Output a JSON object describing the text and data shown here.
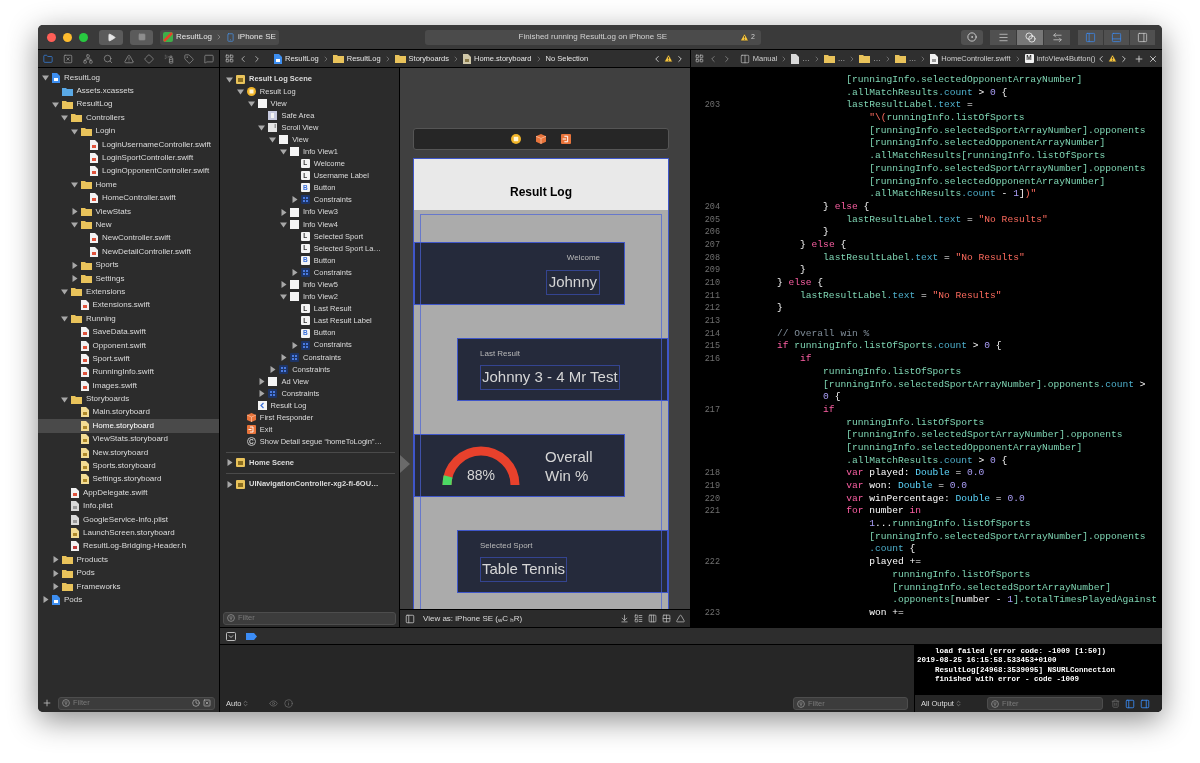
{
  "toolbar": {
    "scheme": "ResultLog",
    "device": "iPhone SE",
    "status": "Finished running ResultLog on iPhone SE",
    "warning_count": "2",
    "editor_modes": [
      {
        "kind": "standard",
        "selected": false
      },
      {
        "kind": "assistant",
        "selected": true
      },
      {
        "kind": "version",
        "selected": false
      }
    ],
    "panels": [
      {
        "kind": "navigator",
        "on": true
      },
      {
        "kind": "debug",
        "on": true
      },
      {
        "kind": "inspector",
        "on": false
      }
    ]
  },
  "navigator": {
    "tabs": [
      {
        "kind": "project",
        "selected": true
      },
      {
        "kind": "source-control",
        "selected": false
      },
      {
        "kind": "symbol",
        "selected": false
      },
      {
        "kind": "find",
        "selected": false
      },
      {
        "kind": "issue",
        "selected": false
      },
      {
        "kind": "test",
        "selected": false
      },
      {
        "kind": "debug",
        "selected": false
      },
      {
        "kind": "breakpoint",
        "selected": false
      },
      {
        "kind": "report",
        "selected": false
      }
    ],
    "tree": [
      {
        "label": "ResultLog",
        "kind": "project",
        "expanded": true,
        "selected": false,
        "children": [
          {
            "label": "Assets.xcassets",
            "kind": "assets",
            "selected": false
          },
          {
            "label": "ResultLog",
            "kind": "folder",
            "expanded": true,
            "selected": false,
            "children": [
              {
                "label": "Controllers",
                "kind": "folder",
                "expanded": true,
                "selected": false,
                "children": [
                  {
                    "label": "Login",
                    "kind": "folder",
                    "expanded": true,
                    "selected": false,
                    "children": [
                      {
                        "label": "LoginUsernameController.swift",
                        "kind": "swift",
                        "selected": false
                      },
                      {
                        "label": "LoginSportController.swift",
                        "kind": "swift",
                        "selected": false
                      },
                      {
                        "label": "LoginOpponentController.swift",
                        "kind": "swift",
                        "selected": false
                      }
                    ]
                  },
                  {
                    "label": "Home",
                    "kind": "folder",
                    "expanded": true,
                    "selected": false,
                    "children": [
                      {
                        "label": "HomeController.swift",
                        "kind": "swift",
                        "selected": false
                      }
                    ]
                  },
                  {
                    "label": "ViewStats",
                    "kind": "folder",
                    "expanded": false,
                    "selected": false
                  },
                  {
                    "label": "New",
                    "kind": "folder",
                    "expanded": true,
                    "selected": false,
                    "children": [
                      {
                        "label": "NewController.swift",
                        "kind": "swift",
                        "selected": false
                      },
                      {
                        "label": "NewDetailController.swift",
                        "kind": "swift",
                        "selected": false
                      }
                    ]
                  },
                  {
                    "label": "Sports",
                    "kind": "folder",
                    "expanded": false,
                    "selected": false
                  },
                  {
                    "label": "Settings",
                    "kind": "folder",
                    "expanded": false,
                    "selected": false
                  }
                ]
              },
              {
                "label": "Extensions",
                "kind": "folder",
                "expanded": true,
                "selected": false,
                "children": [
                  {
                    "label": "Extensions.swift",
                    "kind": "swift",
                    "selected": false
                  }
                ]
              },
              {
                "label": "Running",
                "kind": "folder",
                "expanded": true,
                "selected": false,
                "children": [
                  {
                    "label": "SaveData.swift",
                    "kind": "swift",
                    "selected": false
                  },
                  {
                    "label": "Opponent.swift",
                    "kind": "swift",
                    "selected": false
                  },
                  {
                    "label": "Sport.swift",
                    "kind": "swift",
                    "selected": false
                  },
                  {
                    "label": "RunningInfo.swift",
                    "kind": "swift",
                    "selected": false
                  },
                  {
                    "label": "Images.swift",
                    "kind": "swift",
                    "selected": false
                  }
                ]
              },
              {
                "label": "Storyboards",
                "kind": "folder",
                "expanded": true,
                "selected": false,
                "children": [
                  {
                    "label": "Main.storyboard",
                    "kind": "storyboard",
                    "selected": false
                  },
                  {
                    "label": "Home.storyboard",
                    "kind": "storyboard",
                    "selected": true
                  },
                  {
                    "label": "ViewStats.storyboard",
                    "kind": "storyboard",
                    "selected": false
                  },
                  {
                    "label": "New.storyboard",
                    "kind": "storyboard",
                    "selected": false
                  },
                  {
                    "label": "Sports.storyboard",
                    "kind": "storyboard",
                    "selected": false
                  },
                  {
                    "label": "Settings.storyboard",
                    "kind": "storyboard",
                    "selected": false
                  }
                ]
              },
              {
                "label": "AppDelegate.swift",
                "kind": "swift",
                "selected": false
              },
              {
                "label": "Info.plist",
                "kind": "plist",
                "selected": false
              },
              {
                "label": "GoogleService-Info.plist",
                "kind": "plist",
                "selected": false
              },
              {
                "label": "LaunchScreen.storyboard",
                "kind": "storyboard",
                "selected": false
              },
              {
                "label": "ResultLog-Bridging-Header.h",
                "kind": "header",
                "selected": false
              }
            ]
          },
          {
            "label": "Products",
            "kind": "folder",
            "expanded": false,
            "selected": false
          },
          {
            "label": "Pods",
            "kind": "folder",
            "expanded": false,
            "selected": false
          },
          {
            "label": "Frameworks",
            "kind": "folder",
            "expanded": false,
            "selected": false
          }
        ]
      },
      {
        "label": "Pods",
        "kind": "project",
        "expanded": false,
        "selected": false
      }
    ],
    "filter": {
      "placeholder": "Filter"
    }
  },
  "storyboard_editor": {
    "jump_bar": [
      {
        "kind": "project",
        "label": "ResultLog"
      },
      {
        "kind": "folder",
        "label": "ResultLog"
      },
      {
        "kind": "folder",
        "label": "Storyboards"
      },
      {
        "kind": "storyboard",
        "label": "Home.storyboard"
      },
      {
        "kind": "none",
        "label": "No Selection"
      }
    ],
    "outline": [
      {
        "label": "Result Log Scene",
        "kind": "scene",
        "expanded": true,
        "selected": false,
        "children": [
          {
            "label": "Result Log",
            "kind": "view-controller",
            "expanded": true,
            "selected": false,
            "children": [
              {
                "label": "View",
                "kind": "view",
                "expanded": true,
                "selected": false,
                "children": [
                  {
                    "label": "Safe Area",
                    "kind": "safe-area",
                    "selected": false
                  },
                  {
                    "label": "Scroll View",
                    "kind": "scroll-view",
                    "expanded": true,
                    "selected": false,
                    "children": [
                      {
                        "label": "View",
                        "kind": "view",
                        "expanded": true,
                        "selected": false,
                        "children": [
                          {
                            "label": "Info View1",
                            "kind": "view",
                            "expanded": true,
                            "selected": false,
                            "children": [
                              {
                                "label": "Welcome",
                                "kind": "label",
                                "badge": "L",
                                "selected": false
                              },
                              {
                                "label": "Username Label",
                                "kind": "label",
                                "badge": "L",
                                "selected": false
                              },
                              {
                                "label": "Button",
                                "kind": "button",
                                "badge": "B",
                                "selected": false
                              },
                              {
                                "label": "Constraints",
                                "kind": "constraints",
                                "expanded": false,
                                "selected": false
                              }
                            ]
                          },
                          {
                            "label": "Info View3",
                            "kind": "view",
                            "expanded": false,
                            "selected": false
                          },
                          {
                            "label": "Info View4",
                            "kind": "view",
                            "expanded": true,
                            "selected": false,
                            "children": [
                              {
                                "label": "Selected Sport",
                                "kind": "label",
                                "badge": "L",
                                "selected": false
                              },
                              {
                                "label": "Selected Sport La…",
                                "kind": "label",
                                "badge": "L",
                                "selected": false
                              },
                              {
                                "label": "Button",
                                "kind": "button",
                                "badge": "B",
                                "selected": false
                              },
                              {
                                "label": "Constraints",
                                "kind": "constraints",
                                "expanded": false,
                                "selected": false
                              }
                            ]
                          },
                          {
                            "label": "Info View5",
                            "kind": "view",
                            "expanded": false,
                            "selected": false
                          },
                          {
                            "label": "Info View2",
                            "kind": "view",
                            "expanded": true,
                            "selected": false,
                            "children": [
                              {
                                "label": "Last Result",
                                "kind": "label",
                                "badge": "L",
                                "selected": false
                              },
                              {
                                "label": "Last Result Label",
                                "kind": "label",
                                "badge": "L",
                                "selected": false
                              },
                              {
                                "label": "Button",
                                "kind": "button",
                                "badge": "B",
                                "selected": false
                              },
                              {
                                "label": "Constraints",
                                "kind": "constraints",
                                "expanded": false,
                                "selected": false
                              }
                            ]
                          },
                          {
                            "label": "Constraints",
                            "kind": "constraints",
                            "expanded": false,
                            "selected": false
                          }
                        ]
                      },
                      {
                        "label": "Constraints",
                        "kind": "constraints",
                        "expanded": false,
                        "selected": false
                      }
                    ]
                  },
                  {
                    "label": "Ad View",
                    "kind": "view",
                    "expanded": false,
                    "selected": false
                  },
                  {
                    "label": "Constraints",
                    "kind": "constraints",
                    "expanded": false,
                    "selected": false
                  }
                ]
              },
              {
                "label": "Result Log",
                "kind": "navigation-item",
                "selected": false
              }
            ]
          },
          {
            "label": "First Responder",
            "kind": "first-responder",
            "selected": false
          },
          {
            "label": "Exit",
            "kind": "exit",
            "selected": false
          },
          {
            "label": "Show Detail segue “homeToLogin”…",
            "kind": "segue",
            "badge": "C",
            "selected": false
          }
        ]
      },
      {
        "label": "Home Scene",
        "kind": "scene",
        "expanded": false,
        "selected": false
      },
      {
        "label": "UINavigationController-xg2-fi-6OU…",
        "kind": "scene",
        "expanded": false,
        "selected": false
      }
    ],
    "outline_filter": {
      "placeholder": "Filter"
    },
    "canvas": {
      "dock": [
        {
          "kind": "view-controller"
        },
        {
          "kind": "first-responder"
        },
        {
          "kind": "exit"
        }
      ],
      "nav_title": "Result Log",
      "cards": [
        {
          "kind": "greeting",
          "caption": "Welcome",
          "value": "Johnny"
        },
        {
          "kind": "detail",
          "caption": "Last Result",
          "value": "Johnny 3 - 4 Mr Test"
        },
        {
          "kind": "gauge",
          "value": "88%",
          "caption": "Overall Win %"
        },
        {
          "kind": "detail",
          "caption": "Selected Sport",
          "value": "Table Tennis"
        }
      ]
    },
    "view_as": "View as: iPhone SE ($_{w}$C $_{h}$R)"
  },
  "code_editor": {
    "jump_bar": [
      {
        "kind": "manual",
        "label": "Manual"
      },
      {
        "kind": "file",
        "label": "…"
      },
      {
        "kind": "folder",
        "label": "…"
      },
      {
        "kind": "folder",
        "label": "…"
      },
      {
        "kind": "folder",
        "label": "…"
      },
      {
        "kind": "swift",
        "label": "HomeController.swift"
      },
      {
        "kind": "method",
        "badge": "M",
        "label": "infoView4Button()"
      }
    ],
    "lines": [
      {
        "segments": [
          {
            "kind": "ident",
            "text": "                    [runningInfo.selectedOpponentArrayNumber]"
          }
        ]
      },
      {
        "segments": [
          {
            "kind": "ident",
            "text": "                    .allMatchResults"
          },
          {
            "kind": "member",
            "text": ".count"
          },
          {
            "kind": "plain",
            "text": " > "
          },
          {
            "kind": "number",
            "text": "0"
          },
          {
            "kind": "plain",
            "text": " {"
          }
        ]
      },
      {
        "number": "203",
        "segments": [
          {
            "kind": "ident",
            "text": "                    lastResultLabel"
          },
          {
            "kind": "member",
            "text": ".text"
          },
          {
            "kind": "plain",
            "text": " ="
          }
        ]
      },
      {
        "segments": [
          {
            "kind": "string",
            "text": "                        \"\\("
          },
          {
            "kind": "ident",
            "text": "runningInfo.listOfSports"
          }
        ]
      },
      {
        "segments": [
          {
            "kind": "ident",
            "text": "                        [runningInfo.selectedSportArrayNumber].opponents"
          }
        ]
      },
      {
        "segments": [
          {
            "kind": "ident",
            "text": "                        [runningInfo.selectedOpponentArrayNumber]"
          }
        ]
      },
      {
        "segments": [
          {
            "kind": "ident",
            "text": "                        .allMatchResults[runningInfo.listOfSports"
          }
        ]
      },
      {
        "segments": [
          {
            "kind": "ident",
            "text": "                        [runningInfo.selectedSportArrayNumber].opponents"
          }
        ]
      },
      {
        "segments": [
          {
            "kind": "ident",
            "text": "                        [runningInfo.selectedOpponentArrayNumber]"
          }
        ]
      },
      {
        "segments": [
          {
            "kind": "ident",
            "text": "                        .allMatchResults"
          },
          {
            "kind": "member",
            "text": ".count"
          },
          {
            "kind": "plain",
            "text": " - "
          },
          {
            "kind": "number",
            "text": "1"
          },
          {
            "kind": "plain",
            "text": "]"
          },
          {
            "kind": "string",
            "text": ")\""
          }
        ]
      },
      {
        "number": "204",
        "segments": [
          {
            "kind": "plain",
            "text": "                } "
          },
          {
            "kind": "keyword",
            "text": "else"
          },
          {
            "kind": "plain",
            "text": " {"
          }
        ]
      },
      {
        "number": "205",
        "segments": [
          {
            "kind": "ident",
            "text": "                    lastResultLabel"
          },
          {
            "kind": "member",
            "text": ".text"
          },
          {
            "kind": "plain",
            "text": " = "
          },
          {
            "kind": "string",
            "text": "\"No Results\""
          }
        ]
      },
      {
        "number": "206",
        "segments": [
          {
            "kind": "plain",
            "text": "                }"
          }
        ]
      },
      {
        "number": "207",
        "segments": [
          {
            "kind": "plain",
            "text": "            } "
          },
          {
            "kind": "keyword",
            "text": "else"
          },
          {
            "kind": "plain",
            "text": " {"
          }
        ]
      },
      {
        "number": "208",
        "segments": [
          {
            "kind": "ident",
            "text": "                lastResultLabel"
          },
          {
            "kind": "member",
            "text": ".text"
          },
          {
            "kind": "plain",
            "text": " = "
          },
          {
            "kind": "string",
            "text": "\"No Results\""
          }
        ]
      },
      {
        "number": "209",
        "segments": [
          {
            "kind": "plain",
            "text": "            }"
          }
        ]
      },
      {
        "number": "210",
        "segments": [
          {
            "kind": "plain",
            "text": "        } "
          },
          {
            "kind": "keyword",
            "text": "else"
          },
          {
            "kind": "plain",
            "text": " {"
          }
        ]
      },
      {
        "number": "211",
        "segments": [
          {
            "kind": "ident",
            "text": "            lastResultLabel"
          },
          {
            "kind": "member",
            "text": ".text"
          },
          {
            "kind": "plain",
            "text": " = "
          },
          {
            "kind": "string",
            "text": "\"No Results\""
          }
        ]
      },
      {
        "number": "212",
        "segments": [
          {
            "kind": "plain",
            "text": "        }"
          }
        ]
      },
      {
        "number": "213"
      },
      {
        "number": "214",
        "segments": [
          {
            "kind": "comment",
            "text": "        // Overall win %"
          }
        ]
      },
      {
        "number": "215",
        "segments": [
          {
            "kind": "keyword",
            "text": "        if"
          },
          {
            "kind": "ident",
            "text": " runningInfo.listOfSports"
          },
          {
            "kind": "member",
            "text": ".count"
          },
          {
            "kind": "plain",
            "text": " > "
          },
          {
            "kind": "number",
            "text": "0"
          },
          {
            "kind": "plain",
            "text": " {"
          }
        ]
      },
      {
        "number": "216",
        "segments": [
          {
            "kind": "keyword",
            "text": "            if"
          }
        ]
      },
      {
        "segments": [
          {
            "kind": "ident",
            "text": "                runningInfo.listOfSports"
          }
        ]
      },
      {
        "segments": [
          {
            "kind": "ident",
            "text": "                [runningInfo.selectedSportArrayNumber].opponents"
          },
          {
            "kind": "member",
            "text": ".count"
          },
          {
            "kind": "plain",
            "text": " >"
          }
        ]
      },
      {
        "segments": [
          {
            "kind": "number",
            "text": "                0"
          },
          {
            "kind": "plain",
            "text": " {"
          }
        ]
      },
      {
        "number": "217",
        "segments": [
          {
            "kind": "keyword",
            "text": "                if"
          }
        ]
      },
      {
        "segments": [
          {
            "kind": "ident",
            "text": "                    runningInfo.listOfSports"
          }
        ]
      },
      {
        "segments": [
          {
            "kind": "ident",
            "text": "                    [runningInfo.selectedSportArrayNumber].opponents"
          }
        ]
      },
      {
        "segments": [
          {
            "kind": "ident",
            "text": "                    [runningInfo.selectedOpponentArrayNumber]"
          }
        ]
      },
      {
        "segments": [
          {
            "kind": "ident",
            "text": "                    .allMatchResults"
          },
          {
            "kind": "member",
            "text": ".count"
          },
          {
            "kind": "plain",
            "text": " > "
          },
          {
            "kind": "number",
            "text": "0"
          },
          {
            "kind": "plain",
            "text": " {"
          }
        ]
      },
      {
        "number": "218",
        "segments": [
          {
            "kind": "keyword",
            "text": "                    var"
          },
          {
            "kind": "plain",
            "text": " played: "
          },
          {
            "kind": "type",
            "text": "Double"
          },
          {
            "kind": "plain",
            "text": " = "
          },
          {
            "kind": "number",
            "text": "0.0"
          }
        ]
      },
      {
        "number": "219",
        "segments": [
          {
            "kind": "keyword",
            "text": "                    var"
          },
          {
            "kind": "plain",
            "text": " won: "
          },
          {
            "kind": "type",
            "text": "Double"
          },
          {
            "kind": "plain",
            "text": " = "
          },
          {
            "kind": "number",
            "text": "0.0"
          }
        ]
      },
      {
        "number": "220",
        "segments": [
          {
            "kind": "keyword",
            "text": "                    var"
          },
          {
            "kind": "plain",
            "text": " winPercentage: "
          },
          {
            "kind": "type",
            "text": "Double"
          },
          {
            "kind": "plain",
            "text": " = "
          },
          {
            "kind": "number",
            "text": "0.0"
          }
        ]
      },
      {
        "number": "221",
        "segments": [
          {
            "kind": "keyword",
            "text": "                    for"
          },
          {
            "kind": "plain",
            "text": " number "
          },
          {
            "kind": "keyword",
            "text": "in"
          }
        ]
      },
      {
        "segments": [
          {
            "kind": "number",
            "text": "                        1"
          },
          {
            "kind": "plain",
            "text": "..."
          },
          {
            "kind": "ident",
            "text": "runningInfo.listOfSports"
          }
        ]
      },
      {
        "segments": [
          {
            "kind": "ident",
            "text": "                        [runningInfo.selectedSportArrayNumber].opponents"
          }
        ]
      },
      {
        "segments": [
          {
            "kind": "member",
            "text": "                        .count"
          },
          {
            "kind": "plain",
            "text": " {"
          }
        ]
      },
      {
        "number": "222",
        "segments": [
          {
            "kind": "plain",
            "text": "                        played +="
          }
        ]
      },
      {
        "segments": [
          {
            "kind": "ident",
            "text": "                            runningInfo.listOfSports"
          }
        ]
      },
      {
        "segments": [
          {
            "kind": "ident",
            "text": "                            [runningInfo.selectedSportArrayNumber]"
          }
        ]
      },
      {
        "segments": [
          {
            "kind": "ident",
            "text": "                            .opponents["
          },
          {
            "kind": "plain",
            "text": "number - "
          },
          {
            "kind": "number",
            "text": "1"
          },
          {
            "kind": "ident",
            "text": "].totalTimesPlayedAgainst"
          }
        ]
      },
      {
        "number": "223",
        "segments": [
          {
            "kind": "plain",
            "text": "                        won +="
          }
        ]
      }
    ]
  },
  "debug": {
    "variables_scope": "Auto",
    "variables_filter": {
      "placeholder": "Filter"
    },
    "console_lines": [
      "    load failed (error code: -1009 [1:50])",
      "2019-08-25 16:15:58.533453+0100",
      "    ResultLog[24968:3539095] NSURLConnection",
      "    finished with error - code -1009"
    ],
    "output_scope": "All Output",
    "console_filter": {
      "placeholder": "Filter"
    }
  }
}
